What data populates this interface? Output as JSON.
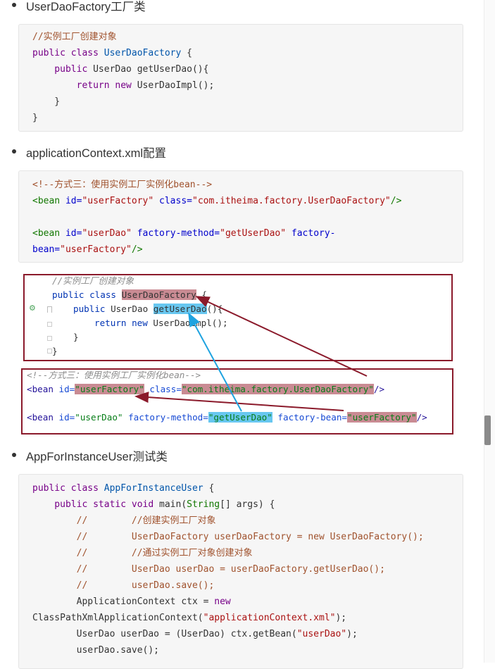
{
  "bullets": {
    "factory": "UserDaoFactory工厂类",
    "xml": "applicationContext.xml配置",
    "app": "AppForInstanceUser测试类"
  },
  "block1": {
    "l1": "//实例工厂创建对象",
    "l2_kw": "public class ",
    "l2_cls": "UserDaoFactory",
    "l2_rest": " {",
    "l3_kw": "    public ",
    "l3_rest": "UserDao getUserDao(){",
    "l4_kw": "        return new ",
    "l4_rest": "UserDaoImpl();",
    "l5": "    }",
    "l6": "}"
  },
  "block2": {
    "l1": "<!--方式三：使用实例工厂实例化bean-->",
    "l2_tag": "<bean ",
    "l2_a1": "id=",
    "l2_v1": "\"userFactory\"",
    "l2_a2": " class=",
    "l2_v2": "\"com.itheima.factory.UserDaoFactory\"",
    "l2_end": "/>",
    "l3_tag": "<bean ",
    "l3_a1": "id=",
    "l3_v1": "\"userDao\"",
    "l3_a2": " factory-method=",
    "l3_v2": "\"getUserDao\"",
    "l3_a3": " factory-",
    "l4_a": "bean=",
    "l4_v": "\"userFactory\"",
    "l4_end": "/>"
  },
  "figure": {
    "c1": "//实例工厂创建对象",
    "c2_kw": "public class ",
    "c2_hl": "UserDaoFactory",
    "c2_rest": " {",
    "c3_kw": "public ",
    "c3_t": "UserDao ",
    "c3_hl": "getUserDao",
    "c3_rest": "(){",
    "c4_kw": "return new ",
    "c4_rest": "UserDaoImpl();",
    "c5": "}",
    "c6": "}",
    "x1": "<!--方式三：使用实例工厂实例化bean-->",
    "x2_tag": "<bean ",
    "x2_a1": "id=",
    "x2_v1": "\"userFactory\"",
    "x2_a2": " class=",
    "x2_v2": "\"com.itheima.factory.UserDaoFactory\"",
    "x2_end": "/>",
    "x3_tag": "<bean ",
    "x3_a1": "id=",
    "x3_v1": "\"userDao\"",
    "x3_a2": " factory-method=",
    "x3_v2": "\"getUserDao\"",
    "x3_a3": " factory-bean=",
    "x3_v3": "\"userFactory\"",
    "x3_end": "/>"
  },
  "block3": {
    "l1_kw": "public class ",
    "l1_cls": "AppForInstanceUser",
    "l1_rest": " {",
    "l2_kw": "    public static void ",
    "l2_rest": "main(",
    "l2_ty": "String",
    "l2_end": "[] args) {",
    "l3_c": "        //        //创建实例工厂对象",
    "l4_c": "        //        UserDaoFactory userDaoFactory = new UserDaoFactory();",
    "l5_c": "        //        //通过实例工厂对象创建对象",
    "l6_c": "        //        UserDao userDao = userDaoFactory.getUserDao();",
    "l7_c": "        //        userDao.save();",
    "l8": "        ApplicationContext ctx = ",
    "l8_kw": "new",
    "l9": "ClassPathXmlApplicationContext(",
    "l9_s": "\"applicationContext.xml\"",
    "l9_end": ");",
    "l10": "        UserDao userDao = (UserDao) ctx.getBean(",
    "l10_s": "\"userDao\"",
    "l10_end": ");",
    "l11": "        userDao.save();"
  },
  "colors": {
    "arrow_red": "#8b1a2b",
    "arrow_blue": "#1fa3e0",
    "highlight_red": "#c98b93",
    "highlight_blue": "#68c7f0"
  }
}
